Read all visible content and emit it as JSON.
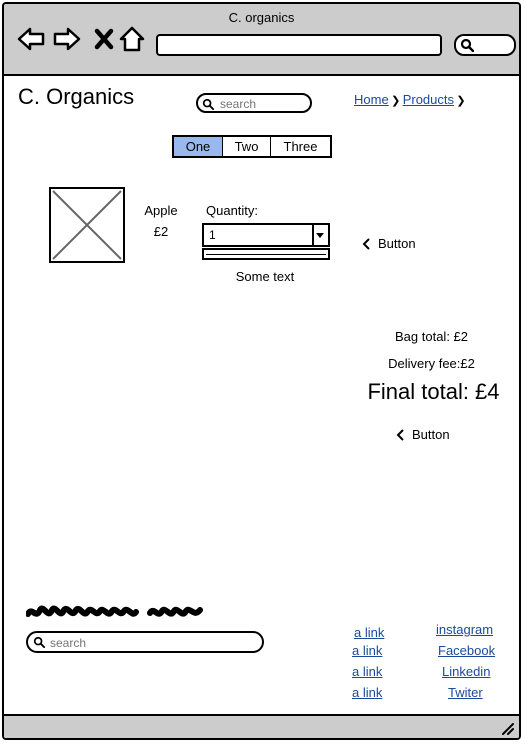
{
  "window": {
    "title": "C. organics"
  },
  "header": {
    "brand": "C. Organics",
    "search_placeholder": "search",
    "breadcrumbs": [
      "Home",
      "Products"
    ]
  },
  "tabs": [
    {
      "label": "One",
      "active": true
    },
    {
      "label": "Two",
      "active": false
    },
    {
      "label": "Three",
      "active": false
    }
  ],
  "product": {
    "name": "Apple",
    "price": "£2",
    "quantity_label": "Quantity:",
    "quantity_value": "1",
    "caption": "Some text",
    "button_label": "Button"
  },
  "summary": {
    "bag_total": "Bag total: £2",
    "delivery_fee": "Delivery fee:£2",
    "final_total": "Final total: £4",
    "button_label": "Button"
  },
  "footer": {
    "search_placeholder": "search",
    "links": [
      "a link",
      "a link",
      "a link",
      "a link"
    ],
    "social": [
      "instagram",
      "Facebook",
      "Linkedin",
      "Twiter"
    ]
  },
  "colors": {
    "chrome": "#cccccc",
    "active_tab": "#99b8ee",
    "link": "#1a4a9c"
  }
}
